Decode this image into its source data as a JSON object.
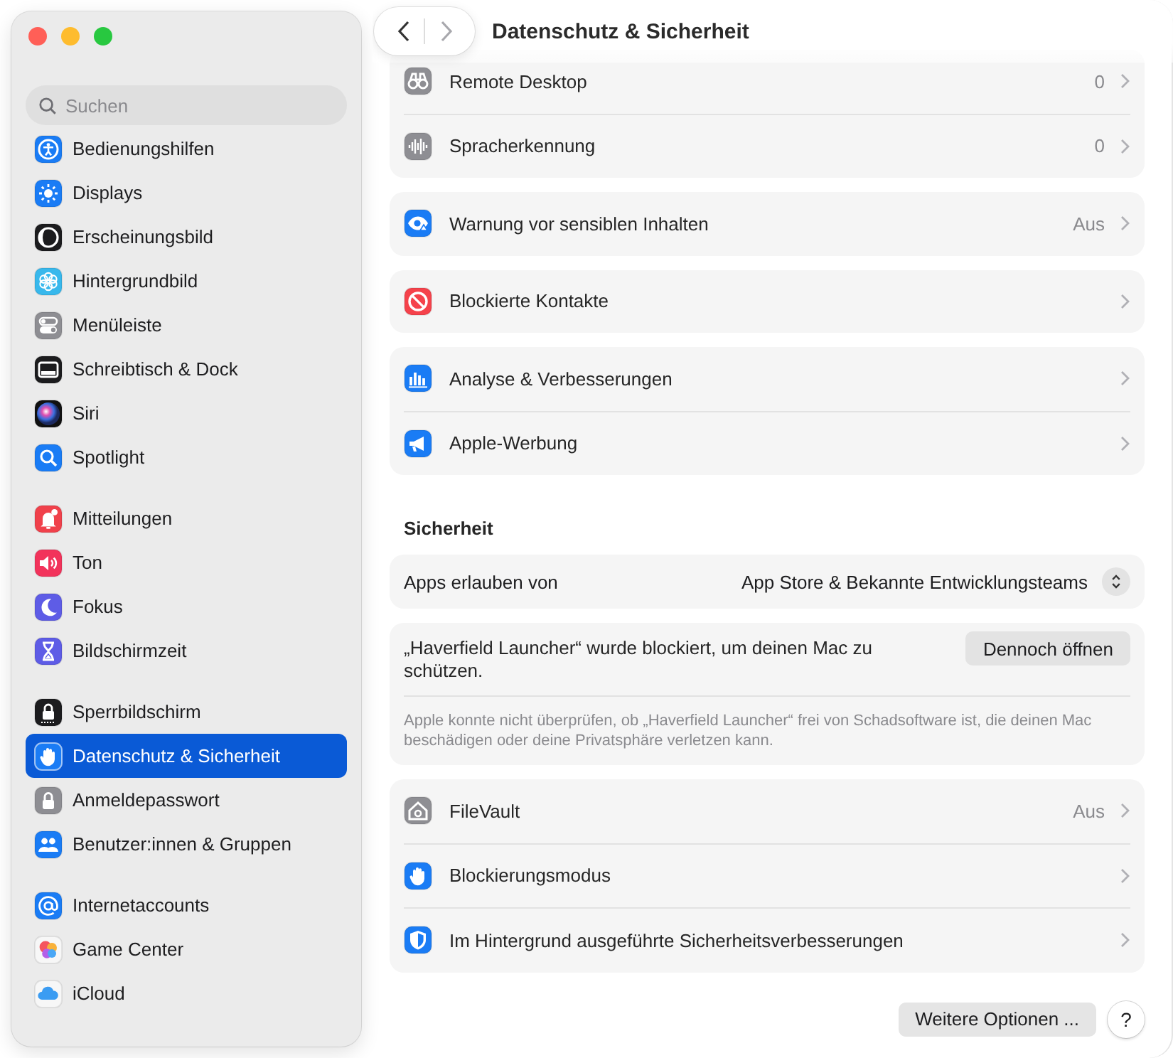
{
  "toolbar": {
    "title": "Datenschutz & Sicherheit",
    "back": {
      "disabled": false
    },
    "forward": {
      "disabled": true
    }
  },
  "sidebar": {
    "search": {
      "placeholder": "Suchen"
    },
    "sections": [
      {
        "items": [
          {
            "label": "Bedienungshilfen",
            "selected": false
          },
          {
            "label": "Displays",
            "selected": false
          },
          {
            "label": "Erscheinungsbild",
            "selected": false
          },
          {
            "label": "Hintergrundbild",
            "selected": false
          },
          {
            "label": "Menüleiste",
            "selected": false
          },
          {
            "label": "Schreibtisch & Dock",
            "selected": false
          },
          {
            "label": "Siri",
            "selected": false
          },
          {
            "label": "Spotlight",
            "selected": false
          }
        ]
      },
      {
        "items": [
          {
            "label": "Mitteilungen",
            "selected": false
          },
          {
            "label": "Ton",
            "selected": false
          },
          {
            "label": "Fokus",
            "selected": false
          },
          {
            "label": "Bildschirmzeit",
            "selected": false
          }
        ]
      },
      {
        "items": [
          {
            "label": "Sperrbildschirm",
            "selected": false
          },
          {
            "label": "Datenschutz & Sicherheit",
            "selected": true
          },
          {
            "label": "Anmeldepasswort",
            "selected": false
          },
          {
            "label": "Benutzer:innen & Gruppen",
            "selected": false
          }
        ]
      },
      {
        "items": [
          {
            "label": "Internetaccounts",
            "selected": false
          },
          {
            "label": "Game Center",
            "selected": false
          },
          {
            "label": "iCloud",
            "selected": false
          }
        ]
      }
    ]
  },
  "content": [
    {
      "kind": "card",
      "rows": [
        {
          "label": "Remote Desktop",
          "value": "0"
        },
        {
          "label": "Spracherkennung",
          "value": "0"
        }
      ]
    },
    {
      "kind": "card",
      "rows": [
        {
          "label": "Warnung vor sensiblen Inhalten",
          "value": "Aus"
        }
      ]
    },
    {
      "kind": "card",
      "rows": [
        {
          "label": "Blockierte Kontakte"
        }
      ]
    },
    {
      "kind": "card",
      "rows": [
        {
          "label": "Analyse & Verbesserungen"
        },
        {
          "label": "Apple-Werbung"
        }
      ]
    },
    {
      "kind": "heading",
      "text": "Sicherheit"
    },
    {
      "kind": "popup",
      "label": "Apps erlauben von",
      "value": "App Store & Bekannte Entwicklungsteams"
    },
    {
      "kind": "alert",
      "message": "„Haverfield Launcher“ wurde blockiert, um deinen Mac zu schützen.",
      "button": "Dennoch öffnen",
      "note": "Apple konnte nicht überprüfen, ob „Haverfield Launcher“ frei von Schadsoftware ist, die deinen Mac beschädigen oder deine Privatsphäre verletzen kann."
    },
    {
      "kind": "card",
      "rows": [
        {
          "label": "FileVault",
          "value": "Aus"
        },
        {
          "label": "Blockierungsmodus"
        },
        {
          "label": "Im Hintergrund ausgeführte Sicherheitsverbesserungen"
        }
      ]
    }
  ],
  "footer": {
    "button": "Weitere Optionen ...",
    "help": "?"
  }
}
